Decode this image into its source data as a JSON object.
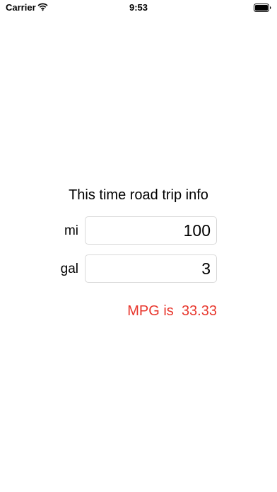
{
  "status_bar": {
    "carrier": "Carrier",
    "time": "9:53",
    "wifi_icon": "wifi-icon",
    "battery_icon": "battery-icon"
  },
  "main": {
    "title": "This time road trip info",
    "miles": {
      "label": "mi",
      "value": "100"
    },
    "gallons": {
      "label": "gal",
      "value": "3"
    },
    "result": {
      "label": "MPG is",
      "value": "33.33",
      "color": "#e8362c"
    }
  }
}
